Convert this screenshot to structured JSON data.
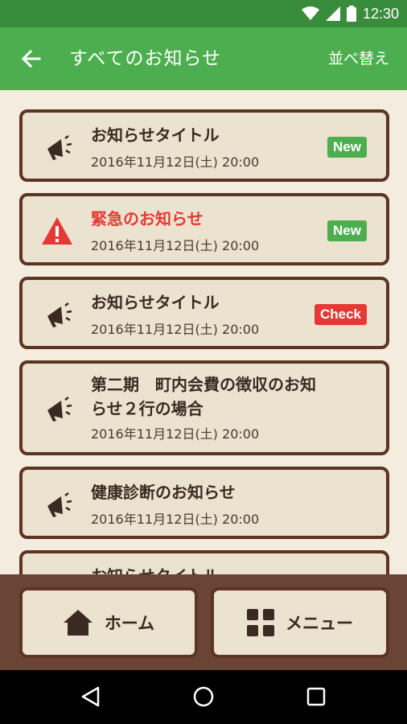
{
  "status_bar": {
    "time": "12:30",
    "icons": [
      "wifi-icon",
      "signal-icon",
      "battery-icon"
    ]
  },
  "app_bar": {
    "title": "すべてのお知らせ",
    "sort_label": "並べ替え",
    "back_icon": "back-arrow-icon"
  },
  "notices": [
    {
      "icon": "megaphone-icon",
      "title_lines": [
        "お知らせタイトル"
      ],
      "date": "2016年11月12日(土)  20:00",
      "badge": "New",
      "badge_type": "new"
    },
    {
      "icon": "warning-icon",
      "title_lines": [
        "緊急のお知らせ"
      ],
      "date": "2016年11月12日(土)  20:00",
      "badge": "New",
      "badge_type": "new",
      "urgent": true
    },
    {
      "icon": "megaphone-icon",
      "title_lines": [
        "お知らせタイトル"
      ],
      "date": "2016年11月12日(土)  20:00",
      "badge": "Check",
      "badge_type": "check"
    },
    {
      "icon": "megaphone-icon",
      "title_lines": [
        "第二期　町内会費の徴収のお知",
        "らせ２行の場合"
      ],
      "date": "2016年11月12日(土)  20:00"
    },
    {
      "icon": "megaphone-icon",
      "title_lines": [
        "健康診断のお知らせ"
      ],
      "date": "2016年11月12日(土)  20:00"
    },
    {
      "icon": "megaphone-icon",
      "title_lines": [
        "お知らせタイトル"
      ],
      "date": ""
    }
  ],
  "bottom_nav": {
    "home": {
      "label": "ホーム",
      "icon": "home-icon"
    },
    "menu": {
      "label": "メニュー",
      "icon": "grid-icon"
    }
  },
  "system_nav": [
    "back-triangle-icon",
    "home-circle-icon",
    "recents-square-icon"
  ],
  "colors": {
    "primary_green": "#4cae4f",
    "dark_green": "#3a8c3d",
    "brown": "#5c3421",
    "card_bg": "#ece2d0",
    "alert_red": "#e53935"
  }
}
